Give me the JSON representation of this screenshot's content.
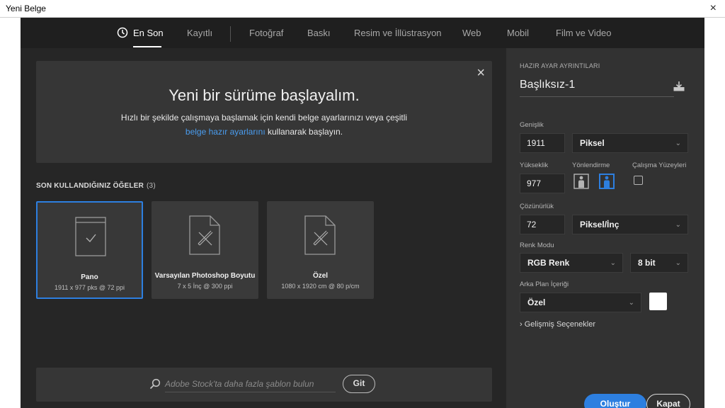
{
  "window": {
    "title": "Yeni Belge",
    "close_glyph": "×"
  },
  "tabs": [
    {
      "label": "En Son",
      "active": true
    },
    {
      "label": "Kayıtlı"
    },
    {
      "label": "Fotoğraf"
    },
    {
      "label": "Baskı"
    },
    {
      "label": "Resim ve İllüstrasyon"
    },
    {
      "label": "Web"
    },
    {
      "label": "Mobil"
    },
    {
      "label": "Film ve Video"
    }
  ],
  "welcome": {
    "close_glyph": "×",
    "heading": "Yeni bir sürüme başlayalım.",
    "line1": "Hızlı bir şekilde çalışmaya başlamak için kendi belge ayarlarınızı veya çeşitli",
    "line2_link": "belge hazır ayarlarını",
    "line2_rest": " kullanarak başlayın."
  },
  "recent": {
    "heading": "SON KULLANDIĞINIZ ÖĞELER",
    "count": "(3)",
    "items": [
      {
        "name": "Pano",
        "meta": "1911 x 977 pks @ 72 ppi",
        "icon": "artboard-icon",
        "selected": true
      },
      {
        "name": "Varsayılan Photoshop Boyutu",
        "meta": "7 x 5 İnç @ 300 ppi",
        "icon": "document-pencil-icon"
      },
      {
        "name": "Özel",
        "meta": "1080 x 1920 cm @ 80 p/cm",
        "icon": "document-pencil-icon"
      }
    ]
  },
  "stock": {
    "placeholder": "Adobe Stock'ta daha fazla şablon bulun",
    "go_label": "Git"
  },
  "preset": {
    "heading": "HAZIR AYAR AYRINTILARI",
    "doc_name": "Başlıksız-1",
    "width_label": "Genişlik",
    "width_value": "1911",
    "width_unit": "Piksel",
    "height_label": "Yükseklik",
    "height_value": "977",
    "orientation_label": "Yönlendirme",
    "artboards_label": "Çalışma Yüzeyleri",
    "resolution_label": "Çözünürlük",
    "resolution_value": "72",
    "resolution_unit": "Piksel/İnç",
    "color_mode_label": "Renk Modu",
    "color_mode": "RGB Renk",
    "bit_depth": "8 bit",
    "bg_label": "Arka Plan İçeriği",
    "bg_value": "Özel",
    "bg_color": "#ffffff",
    "advanced": "› Gelişmiş Seçenekler",
    "create_label": "Oluştur",
    "close_label": "Kapat"
  },
  "colors": {
    "accent": "#2d7fe0",
    "link": "#4a9df0"
  }
}
